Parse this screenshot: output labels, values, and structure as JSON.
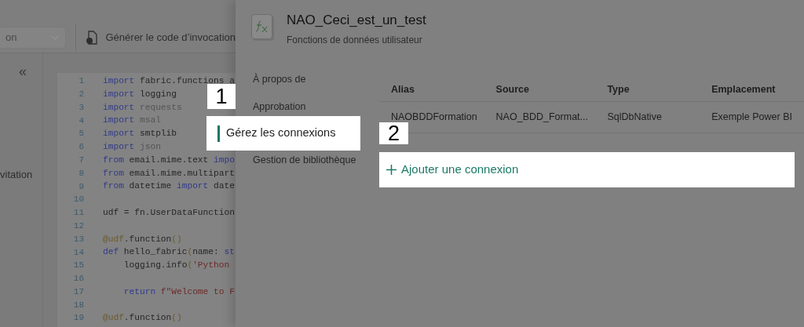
{
  "toolbar": {
    "dropdown_text": "on",
    "invoke_button": "Générer le code d’invocation"
  },
  "left_sidebar": {
    "collapse": "«",
    "item": "vitation"
  },
  "code": [
    {
      "number": "1",
      "tokens": [
        {
          "text": "import",
          "kind": "kw"
        },
        {
          "text": " fabric.functions a",
          "kind": "id"
        }
      ]
    },
    {
      "number": "2",
      "tokens": [
        {
          "text": "import",
          "kind": "kw"
        },
        {
          "text": " logging",
          "kind": "id"
        }
      ]
    },
    {
      "number": "3",
      "tokens": [
        {
          "text": "import",
          "kind": "kw"
        },
        {
          "text": " requests",
          "kind": "dim"
        }
      ]
    },
    {
      "number": "4",
      "tokens": [
        {
          "text": "import",
          "kind": "kw"
        },
        {
          "text": " msal",
          "kind": "dim"
        }
      ]
    },
    {
      "number": "5",
      "tokens": [
        {
          "text": "import",
          "kind": "kw"
        },
        {
          "text": " smtplib",
          "kind": "id"
        }
      ]
    },
    {
      "number": "6",
      "tokens": [
        {
          "text": "import",
          "kind": "kw"
        },
        {
          "text": " json",
          "kind": "dim"
        }
      ]
    },
    {
      "number": "7",
      "tokens": [
        {
          "text": "from",
          "kind": "kw"
        },
        {
          "text": " email.mime.text ",
          "kind": "id"
        },
        {
          "text": "impo",
          "kind": "kw"
        }
      ]
    },
    {
      "number": "8",
      "tokens": [
        {
          "text": "from",
          "kind": "kw"
        },
        {
          "text": " email.mime.multipart",
          "kind": "id"
        }
      ]
    },
    {
      "number": "9",
      "tokens": [
        {
          "text": "from",
          "kind": "kw"
        },
        {
          "text": " datetime ",
          "kind": "id"
        },
        {
          "text": "import",
          "kind": "kw"
        },
        {
          "text": " date",
          "kind": "id"
        }
      ]
    },
    {
      "number": "10"
    },
    {
      "number": "11",
      "tokens": [
        {
          "text": "udf = fn.UserDataFunction",
          "kind": "id"
        }
      ]
    },
    {
      "number": "12"
    },
    {
      "number": "13",
      "tokens": [
        {
          "text": "@udf",
          "kind": "dec"
        },
        {
          "text": ".function",
          "kind": "id"
        },
        {
          "text": "()",
          "kind": "dec"
        }
      ]
    },
    {
      "number": "14",
      "tokens": [
        {
          "text": "def",
          "kind": "kw"
        },
        {
          "text": " hello_fabric",
          "kind": "id"
        },
        {
          "text": "(",
          "kind": "dec"
        },
        {
          "text": "name: ",
          "kind": "id"
        },
        {
          "text": "st",
          "kind": "kw"
        }
      ]
    },
    {
      "number": "15",
      "tokens": [
        {
          "text": "    logging.info",
          "kind": "id"
        },
        {
          "text": "(",
          "kind": "dec"
        },
        {
          "text": "'Python",
          "kind": "str"
        }
      ]
    },
    {
      "number": "16"
    },
    {
      "number": "17",
      "tokens": [
        {
          "text": "    return ",
          "kind": "kw"
        },
        {
          "text": "f\"Welcome to F",
          "kind": "str"
        }
      ]
    },
    {
      "number": "18"
    },
    {
      "number": "19",
      "tokens": [
        {
          "text": "@udf",
          "kind": "dec"
        },
        {
          "text": ".function",
          "kind": "id"
        },
        {
          "text": "()",
          "kind": "dec"
        }
      ]
    }
  ],
  "callouts": [
    "1",
    "2"
  ],
  "panel": {
    "title": "NAO_Ceci_est_un_test",
    "subtitle": "Fonctions de données utilisateur",
    "nav": [
      {
        "label": "À propos de",
        "selected": false
      },
      {
        "label": "Approbation",
        "selected": false
      },
      {
        "label": "Gérez les connexions",
        "selected": true
      },
      {
        "label": "Gestion de bibliothèque",
        "selected": false
      }
    ],
    "table": {
      "columns": [
        "Alias",
        "Source",
        "Type",
        "Emplacement"
      ],
      "rows": [
        [
          "NAOBDDFormation",
          "NAO_BDD_Format...",
          "SqlDbNative",
          "Exemple Power BI"
        ]
      ]
    },
    "add_connection": "Ajouter une connexion"
  }
}
